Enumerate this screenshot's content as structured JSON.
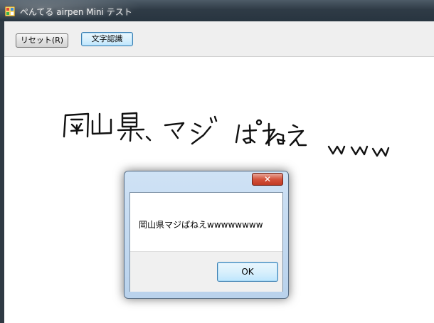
{
  "window": {
    "title": "ぺんてる airpen Mini テスト"
  },
  "toolbar": {
    "reset_label": "リセット(R)",
    "recognize_label": "文字認識"
  },
  "canvas": {
    "handwritten_text": "岡山県マジぱねえwww",
    "ink_color": "#111111"
  },
  "dialog": {
    "close_label": "✕",
    "message": "岡山県マジぱねえwwwwwwww",
    "ok_label": "OK"
  },
  "colors": {
    "titlebar": "#2f3b46",
    "toolbar_bg": "#efefef",
    "accent_button": "#bee6fd",
    "close_button": "#c13a23"
  },
  "icons": {
    "app_icon": "app-icon",
    "close_icon": "close-icon"
  }
}
